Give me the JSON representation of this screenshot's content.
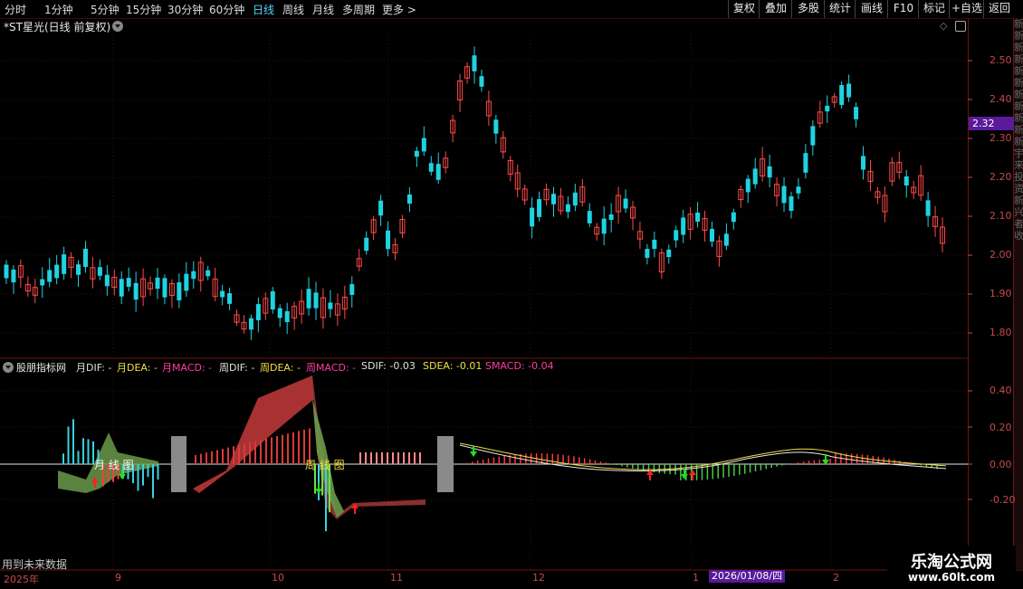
{
  "toolbar": {
    "periods": [
      "分时",
      "1分钟",
      "5分钟",
      "15分钟",
      "30分钟",
      "60分钟",
      "日线",
      "周线",
      "月线",
      "多周期",
      "更多 >"
    ],
    "active_period": "日线",
    "right_buttons": [
      "复权",
      "叠加",
      "多股",
      "统计",
      "画线",
      "F10",
      "标记",
      "+自选",
      "返回"
    ]
  },
  "stock": {
    "title": "*ST星光(日线 前复权)",
    "current_price": "2.32"
  },
  "price_axis": [
    "2.50",
    "2.40",
    "2.30",
    "2.20",
    "2.10",
    "2.00",
    "1.90",
    "1.80"
  ],
  "indicator": {
    "name": "股朋指标网",
    "items": [
      {
        "text": "月DIF: -",
        "color": "#e0e0e0"
      },
      {
        "text": "月DEA: -",
        "color": "#f0e040"
      },
      {
        "text": "月MACD: -",
        "color": "#ff3ea0"
      },
      {
        "text": "周DIF: -",
        "color": "#e0e0e0"
      },
      {
        "text": "周DEA: -",
        "color": "#f0e040"
      },
      {
        "text": "周MACD: -",
        "color": "#ff3ea0"
      },
      {
        "text": "SDIF: -0.03",
        "color": "#e0e0e0"
      },
      {
        "text": "SDEA: -0.01",
        "color": "#f0e040"
      },
      {
        "text": "SMACD: -0.04",
        "color": "#ff3ea0"
      }
    ],
    "axis": [
      "0.40",
      "0.20",
      "0.00",
      "-0.20"
    ],
    "overlay_monthly": "月 线 图",
    "overlay_weekly": "周 线 图",
    "future_note": "用到未来数据"
  },
  "date_axis": {
    "ticks": [
      "2025年",
      "9",
      "10",
      "11",
      "12",
      "1",
      "2"
    ],
    "cursor": "2026/01/08/四"
  },
  "right_strip_text": "新 新 新 新 新 新 新 新 新 新 新 宇 来 投 资 新 兴 者 收",
  "watermark": {
    "title": "乐淘公式网",
    "url": "www.60lt.com"
  },
  "colors": {
    "up": "#ff4a4a",
    "down": "#1fd3e0",
    "grid": "#3a0a0a",
    "accent": "#5a1a9a"
  }
}
